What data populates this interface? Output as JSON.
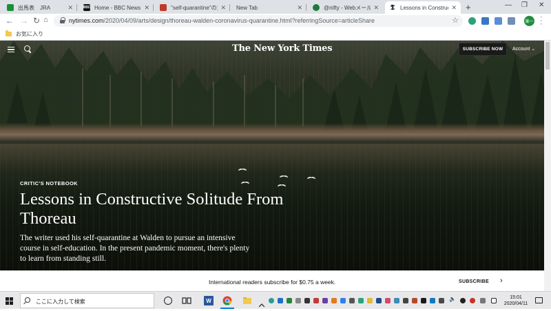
{
  "browser": {
    "tabs": [
      {
        "title": "出馬表　JRA",
        "favicon": "jra-icon",
        "color": "#1a8f3a",
        "active": false
      },
      {
        "title": "Home - BBC News",
        "favicon": "bbc-icon",
        "color": "#111111",
        "active": false
      },
      {
        "title": "\"self-quarantine\"の意味",
        "favicon": "weblio-icon",
        "color": "#c0392b",
        "active": false
      },
      {
        "title": "New Tab",
        "favicon": "",
        "color": "",
        "active": false
      },
      {
        "title": "@nifty - Webメール",
        "favicon": "nifty-icon",
        "color": "#1f7a3d",
        "active": false
      },
      {
        "title": "Lessons in Constructive",
        "favicon": "nyt-icon",
        "color": "#111111",
        "active": true
      }
    ],
    "url_host": "nytimes.com",
    "url_path": "/2020/04/09/arts/design/thoreau-walden-coronavirus-quarantine.html?referringSource=articleShare",
    "profile_initials": "楽一",
    "bookmark_folder": "お気に入り"
  },
  "nyt": {
    "logo": "The New York Times",
    "subscribe_button": "SUBSCRIBE NOW",
    "account": "Account",
    "kicker": "CRITIC'S NOTEBOOK",
    "headline": "Lessons in Constructive Solitude From Thoreau",
    "dek": "The writer used his self-quarantine at Walden to pursue an intensive course in self-education. In the present pandemic moment, there's plenty to learn from standing still."
  },
  "subscribe_bar": {
    "message": "International readers subscribe for $0.75 a week.",
    "link": "SUBSCRIBE"
  },
  "taskbar": {
    "search_placeholder": "ここに入力して検索",
    "time": "15:01",
    "date": "2020/04/11"
  }
}
